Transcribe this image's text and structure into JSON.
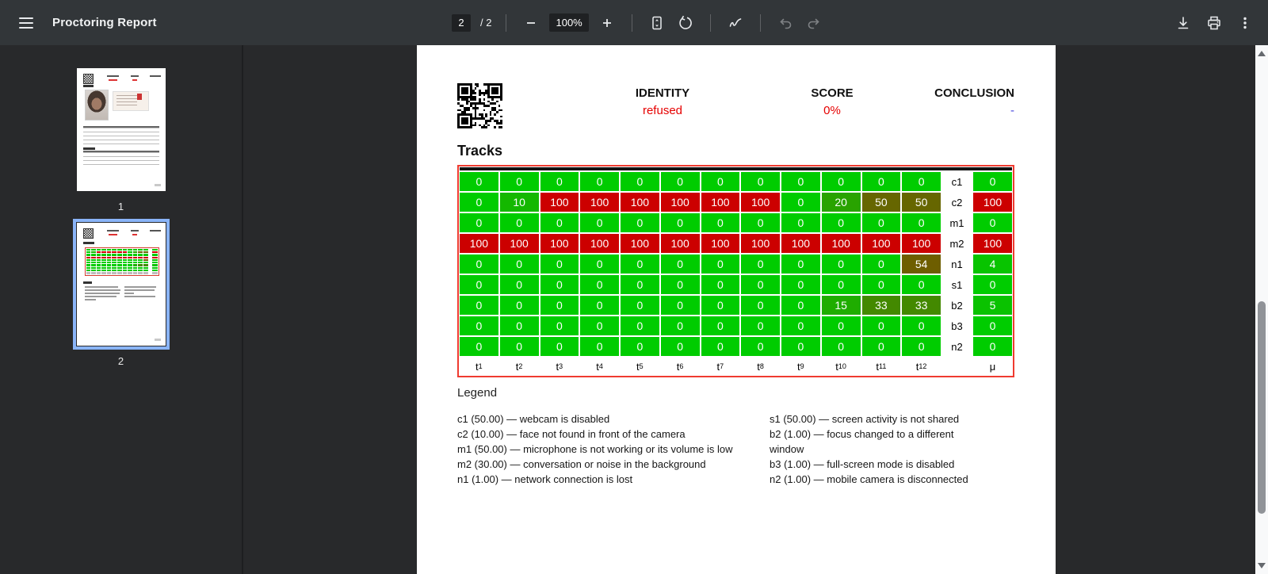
{
  "app": {
    "toolbar": {
      "title": "Proctoring Report",
      "page_current": "2",
      "page_divider": "/",
      "page_total": "2",
      "zoom_value": "100%"
    },
    "thumbnails": [
      {
        "page_label": "1",
        "selected": false
      },
      {
        "page_label": "2",
        "selected": true
      }
    ]
  },
  "document": {
    "header": {
      "identity_label": "IDENTITY",
      "identity_value": "refused",
      "score_label": "SCORE",
      "score_value": "0%",
      "conclusion_label": "CONCLUSION",
      "conclusion_value": "-"
    },
    "tracks_title": "Tracks",
    "legend_title": "Legend",
    "legend_left": [
      "c1 (50.00) — webcam is disabled",
      "c2 (10.00) — face not found in front of the camera",
      "m1 (50.00) — microphone is not working or its volume is low",
      "m2 (30.00) — conversation or noise in the background",
      "n1 (1.00) — network connection is lost"
    ],
    "legend_right": [
      "s1 (50.00) — screen activity is not shared",
      "b2 (1.00) — focus changed to a different window",
      "b3 (1.00) — full-screen mode is disabled",
      "n2 (1.00) — mobile camera is disconnected"
    ]
  },
  "chart_data": {
    "type": "heatmap",
    "title": "Tracks",
    "x_labels": [
      "t1",
      "t2",
      "t3",
      "t4",
      "t5",
      "t6",
      "t7",
      "t8",
      "t9",
      "t10",
      "t11",
      "t12"
    ],
    "mean_label": "μ",
    "rows": [
      {
        "label": "c1",
        "values": [
          0,
          0,
          0,
          0,
          0,
          0,
          0,
          0,
          0,
          0,
          0,
          0
        ],
        "mean": 0
      },
      {
        "label": "c2",
        "values": [
          0,
          10,
          100,
          100,
          100,
          100,
          100,
          100,
          0,
          20,
          50,
          50
        ],
        "mean": 100
      },
      {
        "label": "m1",
        "values": [
          0,
          0,
          0,
          0,
          0,
          0,
          0,
          0,
          0,
          0,
          0,
          0
        ],
        "mean": 0
      },
      {
        "label": "m2",
        "values": [
          100,
          100,
          100,
          100,
          100,
          100,
          100,
          100,
          100,
          100,
          100,
          100
        ],
        "mean": 100
      },
      {
        "label": "n1",
        "values": [
          0,
          0,
          0,
          0,
          0,
          0,
          0,
          0,
          0,
          0,
          0,
          54
        ],
        "mean": 4
      },
      {
        "label": "s1",
        "values": [
          0,
          0,
          0,
          0,
          0,
          0,
          0,
          0,
          0,
          0,
          0,
          0
        ],
        "mean": 0
      },
      {
        "label": "b2",
        "values": [
          0,
          0,
          0,
          0,
          0,
          0,
          0,
          0,
          0,
          15,
          33,
          33
        ],
        "mean": 5
      },
      {
        "label": "b3",
        "values": [
          0,
          0,
          0,
          0,
          0,
          0,
          0,
          0,
          0,
          0,
          0,
          0
        ],
        "mean": 0
      },
      {
        "label": "n2",
        "values": [
          0,
          0,
          0,
          0,
          0,
          0,
          0,
          0,
          0,
          0,
          0,
          0
        ],
        "mean": 0
      }
    ],
    "color_scale": {
      "zero_color": "#00cc00",
      "hundred_color": "#cc0000",
      "range": [
        0,
        100
      ]
    }
  },
  "colors": {
    "header_value_red": "#e60000",
    "conclusion_blue": "#4444dd",
    "table_border_red": "#ef3b30",
    "selected_thumbnail": "#8ab4f8"
  }
}
